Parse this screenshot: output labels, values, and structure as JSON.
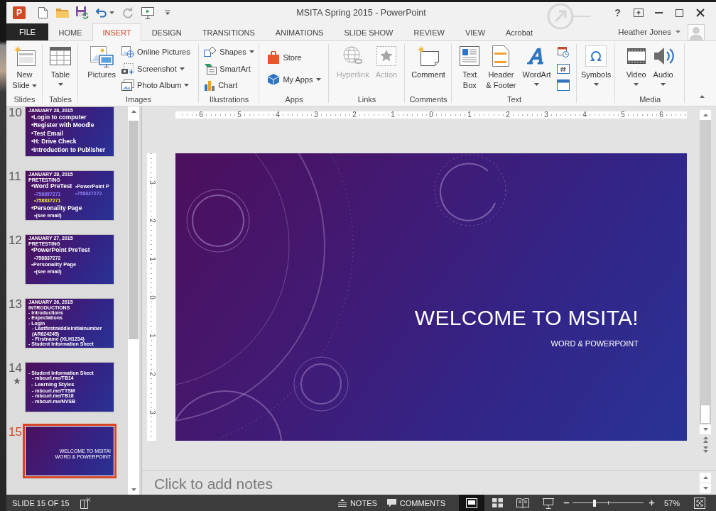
{
  "window": {
    "logo": "P",
    "title": "MSITA Spring 2015 - PowerPoint",
    "help": "?"
  },
  "quick_access": [
    {
      "disabled": false,
      "menu": false
    },
    {
      "disabled": false,
      "menu": false
    },
    {
      "disabled": false,
      "menu": false
    },
    {
      "disabled": false,
      "menu": true
    },
    {
      "disabled": true,
      "menu": false
    },
    {
      "disabled": false,
      "menu": false
    }
  ],
  "tabs": [
    {
      "label": "FILE",
      "kind": "file",
      "selected": false
    },
    {
      "label": "HOME",
      "kind": "tab",
      "selected": false
    },
    {
      "label": "INSERT",
      "kind": "tab",
      "selected": true
    },
    {
      "label": "DESIGN",
      "kind": "tab",
      "selected": false
    },
    {
      "label": "TRANSITIONS",
      "kind": "tab",
      "selected": false
    },
    {
      "label": "ANIMATIONS",
      "kind": "tab",
      "selected": false
    },
    {
      "label": "SLIDE SHOW",
      "kind": "tab",
      "selected": false
    },
    {
      "label": "REVIEW",
      "kind": "tab",
      "selected": false
    },
    {
      "label": "VIEW",
      "kind": "tab",
      "selected": false
    },
    {
      "label": "Acrobat",
      "kind": "tab",
      "selected": false
    }
  ],
  "account": {
    "name": "Heather Jones"
  },
  "ribbon": {
    "groups": [
      {
        "label": "Slides",
        "items": [
          {
            "kind": "large",
            "label": [
              "New",
              "Slide"
            ],
            "menu": true,
            "disabled": false
          }
        ]
      },
      {
        "label": "Tables",
        "items": [
          {
            "kind": "large",
            "label": [
              "Table"
            ],
            "menu": true,
            "disabled": false
          }
        ]
      },
      {
        "label": "Images",
        "items": [
          {
            "kind": "large",
            "label": [
              "Pictures"
            ],
            "menu": false,
            "disabled": false
          },
          {
            "kind": "small",
            "label": "Online Pictures",
            "menu": false,
            "disabled": false
          },
          {
            "kind": "small",
            "label": "Screenshot",
            "menu": true,
            "disabled": false
          },
          {
            "kind": "small",
            "label": "Photo Album",
            "menu": true,
            "disabled": false
          }
        ]
      },
      {
        "label": "Illustrations",
        "items": [
          {
            "kind": "small",
            "label": "Shapes",
            "menu": true,
            "disabled": false
          },
          {
            "kind": "small",
            "label": "SmartArt",
            "menu": false,
            "disabled": false
          },
          {
            "kind": "small",
            "label": "Chart",
            "menu": false,
            "disabled": false
          }
        ]
      },
      {
        "label": "Apps",
        "items": [
          {
            "kind": "small",
            "label": "Store",
            "menu": false,
            "disabled": false
          },
          {
            "kind": "small",
            "label": "My Apps",
            "menu": true,
            "disabled": false
          }
        ]
      },
      {
        "label": "Links",
        "items": [
          {
            "kind": "large",
            "label": [
              "Hyperlink"
            ],
            "menu": false,
            "disabled": true
          },
          {
            "kind": "large",
            "label": [
              "Action"
            ],
            "menu": false,
            "disabled": true
          }
        ]
      },
      {
        "label": "Comments",
        "items": [
          {
            "kind": "large",
            "label": [
              "Comment"
            ],
            "menu": false,
            "disabled": false
          }
        ]
      },
      {
        "label": "Text",
        "items": [
          {
            "kind": "large",
            "label": [
              "Text",
              "Box"
            ],
            "menu": false,
            "disabled": false
          },
          {
            "kind": "large",
            "label": [
              "Header",
              "& Footer"
            ],
            "menu": false,
            "disabled": false
          },
          {
            "kind": "large",
            "label": [
              "WordArt"
            ],
            "menu": true,
            "disabled": false
          },
          {
            "kind": "icon",
            "menu": false,
            "disabled": false
          },
          {
            "kind": "icon",
            "menu": false,
            "disabled": false
          },
          {
            "kind": "icon",
            "menu": false,
            "disabled": false
          }
        ]
      },
      {
        "items": [
          {
            "kind": "large",
            "label": [
              "Symbols"
            ],
            "menu": true,
            "disabled": false
          }
        ]
      },
      {
        "label": "Media",
        "items": [
          {
            "kind": "large",
            "label": [
              "Video"
            ],
            "menu": true,
            "disabled": false
          },
          {
            "kind": "large",
            "label": [
              "Audio"
            ],
            "menu": true,
            "disabled": false
          }
        ]
      }
    ]
  },
  "slides": [
    {
      "number": "10",
      "selected": false,
      "animated": false,
      "kind": "content",
      "lines": [
        {
          "kind": "date",
          "text": "JANUARY 28, 2015"
        },
        {
          "kind": "bullet",
          "text": "•Login to computer"
        },
        {
          "kind": "bullet",
          "text": "•Register with Moodle"
        },
        {
          "kind": "bullet",
          "text": "•Test Email"
        },
        {
          "kind": "bullet",
          "text": "•H: Drive Check"
        },
        {
          "kind": "bullet",
          "text": "•Introduction to Publisher"
        }
      ]
    },
    {
      "number": "11",
      "selected": false,
      "animated": false,
      "kind": "content",
      "lines": [
        {
          "kind": "date",
          "text": "JANUARY 28, 2015",
          "color": "#ffffff"
        },
        {
          "kind": "date",
          "text": "PRETESTING",
          "color": "#ffffff"
        },
        {
          "kind": "bullet",
          "text": "•Word PreTest",
          "color": "#ffffff"
        },
        {
          "kind": "sub",
          "text": "•758857271",
          "color": "#8c82f5"
        },
        {
          "kind": "sub",
          "text": "•758837271",
          "color": "#f5ef3c"
        },
        {
          "kind": "bullet",
          "text": "•Personality Page",
          "color": "#ffffff"
        },
        {
          "kind": "sub",
          "text": "•(see email)",
          "color": "#ffffff"
        }
      ],
      "side_lines": [
        {
          "kind": "side",
          "text": "•PowerPoint P",
          "color": "#ffffff"
        },
        {
          "kind": "side",
          "text": "•758837272",
          "color": "#8c82f5"
        }
      ]
    },
    {
      "number": "12",
      "selected": false,
      "animated": false,
      "kind": "content",
      "lines": [
        {
          "kind": "date",
          "text": "JANUARY 27, 2015"
        },
        {
          "kind": "date",
          "text": "PRETESTING"
        },
        {
          "kind": "bullet",
          "text": "•PowerPoint PreTest"
        },
        {
          "kind": "sub",
          "text": "•758837272"
        },
        {
          "kind": "item",
          "text": "•Personality Page"
        },
        {
          "kind": "sub",
          "text": "•(see email)"
        }
      ]
    },
    {
      "number": "13",
      "selected": false,
      "animated": false,
      "kind": "content",
      "lines": [
        {
          "kind": "date",
          "text": "JANUARY 26, 2015"
        },
        {
          "kind": "date",
          "text": "INTRODUCTIONS"
        },
        {
          "kind": "tiny",
          "text": "- Introductions"
        },
        {
          "kind": "tiny",
          "text": "- Expectations"
        },
        {
          "kind": "tiny",
          "text": "- Login"
        },
        {
          "kind": "tiny_sub",
          "text": "- Lastfirstmiddleinitialnumber"
        },
        {
          "kind": "tiny_sub",
          "text": "(AR624245)"
        },
        {
          "kind": "tiny_sub",
          "text": "- Firstname (XLH1234)"
        },
        {
          "kind": "tiny",
          "text": "- Student Information Sheet"
        }
      ]
    },
    {
      "number": "14",
      "selected": false,
      "animated": true,
      "kind": "section",
      "lines": [
        {
          "kind": "tiny",
          "text": "- Student Information Sheet"
        },
        {
          "kind": "tiny_sub",
          "text": "- mbcurl.me/TB14"
        },
        {
          "kind": "item",
          "text": "- Learning Styles"
        },
        {
          "kind": "url",
          "text": "- mbcurl.me/TTSM"
        },
        {
          "kind": "url",
          "text": "- mbcurl.me/TB18"
        },
        {
          "kind": "url",
          "text": "- mbcurl.me/NVSB"
        }
      ]
    },
    {
      "number": "15",
      "selected": true,
      "animated": false,
      "kind": "title",
      "lines": [
        {
          "kind": "title",
          "text": "WELCOME TO MSITA!"
        },
        {
          "kind": "subtitle",
          "text": "WORD & POWERPOINT"
        }
      ]
    }
  ],
  "rulers": {
    "horizontal": [
      "6",
      "5",
      "4",
      "3",
      "2",
      "1",
      "0",
      "1",
      "2",
      "3",
      "4",
      "5",
      "6"
    ],
    "vertical": [
      "3",
      "2",
      "1",
      "0",
      "1",
      "2",
      "3"
    ]
  },
  "slide": {
    "title": "WELCOME TO MSITA!",
    "subtitle": "WORD & POWERPOINT"
  },
  "notes": {
    "placeholder": "Click to add notes"
  },
  "status_bar": {
    "slide_indicator": "SLIDE 15 OF 15",
    "notes": "NOTES",
    "comments": "COMMENTS",
    "views": [
      {
        "selected": true
      },
      {
        "selected": false
      },
      {
        "selected": false
      },
      {
        "selected": false
      }
    ],
    "zoom": {
      "level": 0.31,
      "reading": "57%"
    }
  }
}
